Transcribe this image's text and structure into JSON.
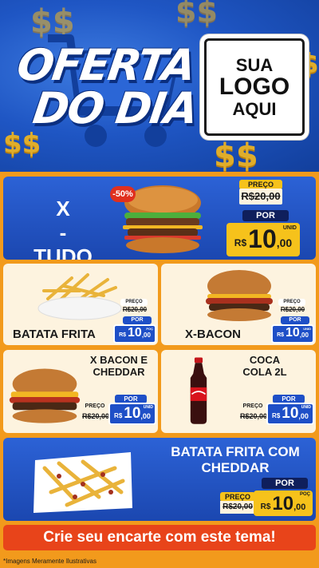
{
  "hero": {
    "title_line1": "OFERTA",
    "title_line2": "DO DIA",
    "logo_line1": "SUA",
    "logo_line2": "LOGO",
    "logo_line3": "AQUI",
    "currency_decor": "$$"
  },
  "products": [
    {
      "name": "X - TUDO",
      "price_label": "PREÇO",
      "old_price": "R$20,00",
      "por_label": "POR",
      "currency": "R$",
      "new_price": "10",
      "cents": ",00",
      "unit": "UNID",
      "discount": "-50%"
    },
    {
      "name": "BATATA FRITA",
      "price_label": "PREÇO",
      "old_price": "R$20,00",
      "por_label": "POR",
      "currency": "R$",
      "new_price": "10",
      "cents": ",00",
      "unit": "POÇ"
    },
    {
      "name": "X-BACON",
      "price_label": "PREÇO",
      "old_price": "R$20,00",
      "por_label": "POR",
      "currency": "R$",
      "new_price": "10",
      "cents": ",00",
      "unit": "UNID"
    },
    {
      "name": "X BACON E CHEDDAR",
      "price_label": "PREÇO",
      "old_price": "R$20,00",
      "por_label": "POR",
      "currency": "R$",
      "new_price": "10",
      "cents": ",00",
      "unit": "UNID"
    },
    {
      "name": "COCA COLA 2L",
      "price_label": "PREÇO",
      "old_price": "R$20,00",
      "por_label": "POR",
      "currency": "R$",
      "new_price": "10",
      "cents": ",00",
      "unit": "UNID"
    },
    {
      "name": "BATATA FRITA COM CHEDDAR",
      "price_label": "PREÇO",
      "old_price": "R$20,00",
      "por_label": "POR",
      "currency": "R$",
      "new_price": "10",
      "cents": ",00",
      "unit": "POÇ"
    }
  ],
  "cta": "Crie seu encarte com este tema!",
  "footer": "*Imagens Meramente Ilustrativas",
  "colors": {
    "primary_blue": "#1f56c4",
    "accent_yellow": "#f6c21b",
    "accent_orange": "#f29a1c",
    "cta_red": "#e8441a",
    "navy": "#0f1f5c"
  }
}
